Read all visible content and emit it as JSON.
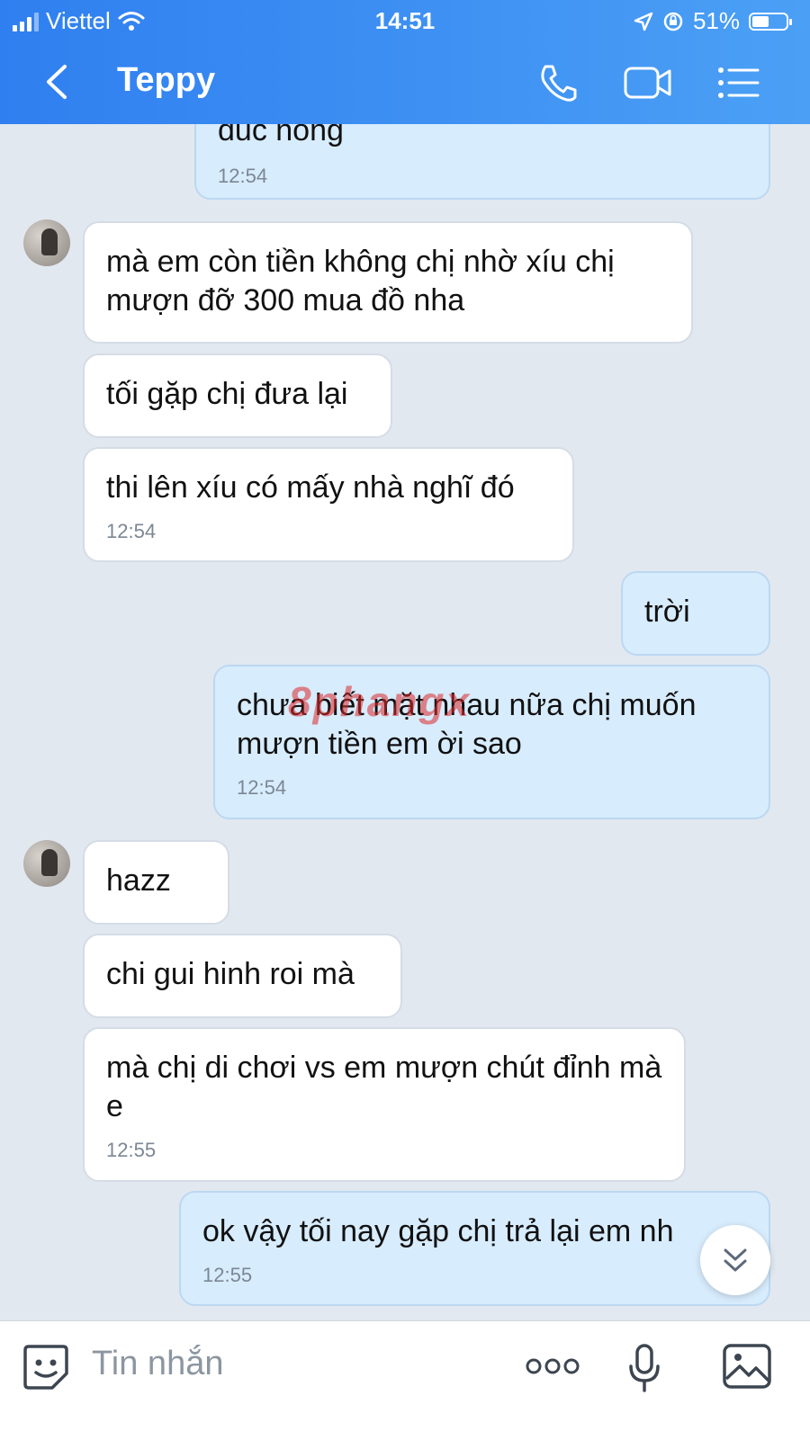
{
  "status_bar": {
    "carrier": "Viettel",
    "time": "14:51",
    "battery": "51%",
    "battery_level": 0.51
  },
  "header": {
    "title": "Teppy",
    "icons": [
      "back-chevron-icon",
      "phone-icon",
      "video-icon",
      "menu-icon"
    ]
  },
  "messages": [
    {
      "dir": "out",
      "text": "đuc nong",
      "time": "12:54"
    },
    {
      "dir": "in",
      "text": "mà em còn tiền không chị nhờ xíu chị mượn đỡ 300 mua đồ nha"
    },
    {
      "dir": "in",
      "text": "tối gặp chị đưa lại"
    },
    {
      "dir": "in",
      "text": "thi lên xíu có mấy nhà nghĩ đó",
      "time": "12:54"
    },
    {
      "dir": "out",
      "text": "trời"
    },
    {
      "dir": "out",
      "text": "chưa biết mặt nhau nữa chị muốn mượn tiền em ời sao",
      "time": "12:54"
    },
    {
      "dir": "in",
      "text": "hazz"
    },
    {
      "dir": "in",
      "text": "chi gui hinh roi mà"
    },
    {
      "dir": "in",
      "text": "mà chị di chơi vs em mượn chút đỉnh mà e",
      "time": "12:55"
    },
    {
      "dir": "out",
      "text": "ok vậy tối nay gặp chị trả lại em nh",
      "time": "12:55"
    }
  ],
  "watermark": "8phangx",
  "input": {
    "placeholder": "Tin nhắn",
    "icons": [
      "sticker-icon",
      "more-options-icon",
      "microphone-icon",
      "image-icon"
    ]
  },
  "colors": {
    "header": "#3b8ff2",
    "outgoing_bubble": "#d7ecfd",
    "incoming_bubble": "#ffffff",
    "background": "#e2e8f0"
  }
}
